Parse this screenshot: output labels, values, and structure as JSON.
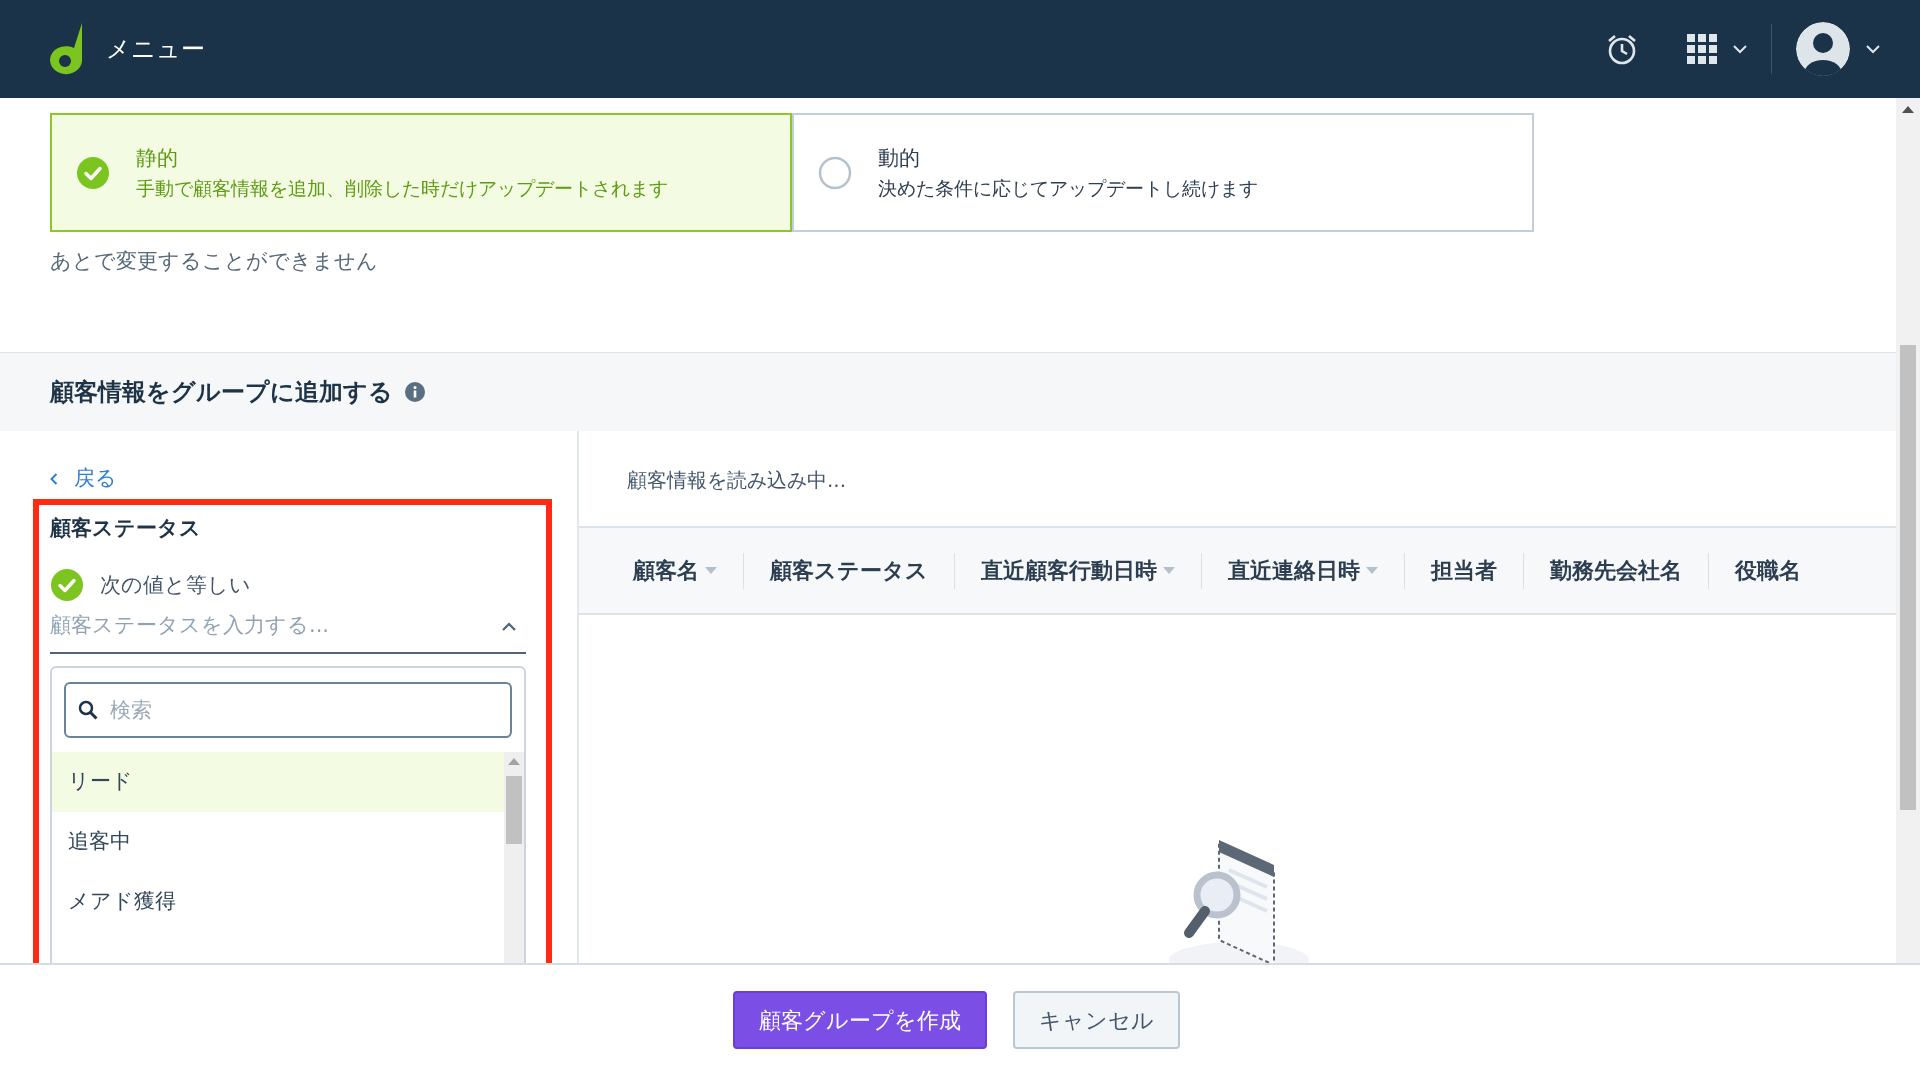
{
  "header": {
    "menu_label": "メニュー"
  },
  "group_type": {
    "options": [
      {
        "title": "静的",
        "description": "手動で顧客情報を追加、削除した時だけアップデートされます",
        "selected": true
      },
      {
        "title": "動的",
        "description": "決めた条件に応じてアップデートし続けます",
        "selected": false
      }
    ],
    "note": "あとで変更することができません"
  },
  "section": {
    "title": "顧客情報をグループに追加する"
  },
  "filter": {
    "back_link": "戻る",
    "field_title": "顧客ステータス",
    "condition": {
      "label": "次の値と等しい",
      "checked": true
    },
    "combobox": {
      "placeholder": "顧客ステータスを入力する...",
      "expanded": true
    },
    "search": {
      "placeholder": "検索"
    },
    "options": [
      {
        "label": "リード",
        "selected": true
      },
      {
        "label": "追客中",
        "selected": false
      },
      {
        "label": "メアド獲得",
        "selected": false
      }
    ]
  },
  "results": {
    "loading_text": "顧客情報を読み込み中...",
    "columns": [
      {
        "label": "顧客名",
        "sortable": true
      },
      {
        "label": "顧客ステータス",
        "sortable": false
      },
      {
        "label": "直近顧客行動日時",
        "sortable": true
      },
      {
        "label": "直近連絡日時",
        "sortable": true
      },
      {
        "label": "担当者",
        "sortable": false
      },
      {
        "label": "勤務先会社名",
        "sortable": false
      },
      {
        "label": "役職名",
        "sortable": false
      }
    ]
  },
  "footer": {
    "buttons": [
      {
        "label": "顧客グループを作成",
        "kind": "primary"
      },
      {
        "label": "キャンセル",
        "kind": "secondary"
      }
    ]
  }
}
